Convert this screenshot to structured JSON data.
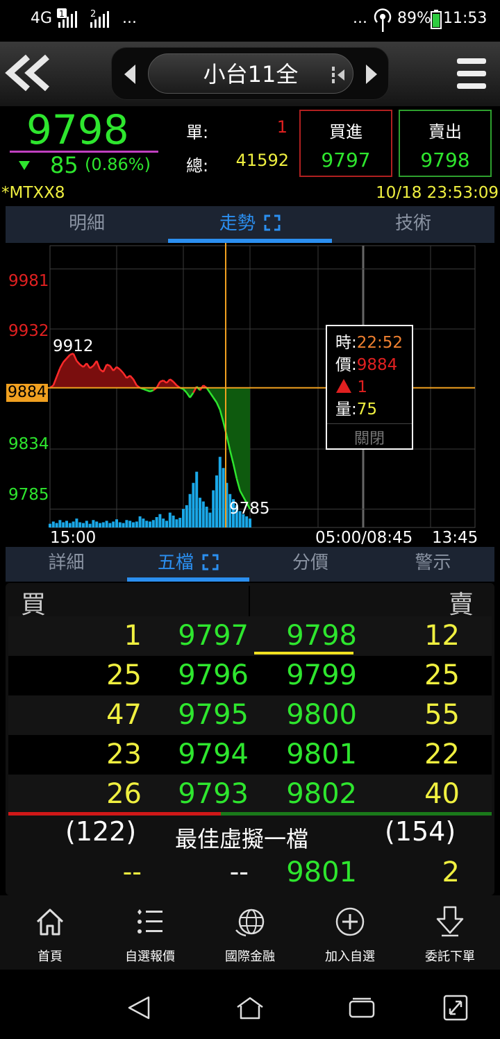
{
  "status": {
    "signal_text": "4G",
    "sim1": "1",
    "sim2": "2",
    "dots_left": "...",
    "dots_right": "...",
    "battery": "89%",
    "time": "11:53"
  },
  "header": {
    "title": "小台11全"
  },
  "quote": {
    "last_price": "9798",
    "change": "85",
    "change_pct": "(0.86%)",
    "single_label": "單:",
    "single_value": "1",
    "total_label": "總:",
    "total_value": "41592",
    "buy_label": "買進",
    "buy_price": "9797",
    "sell_label": "賣出",
    "sell_price": "9798"
  },
  "symbol": {
    "code": "*MTXX8",
    "datetime": "10/18 23:53:09"
  },
  "tabs_top": [
    {
      "label": "明細"
    },
    {
      "label": "走勢"
    },
    {
      "label": "技術"
    }
  ],
  "chart": {
    "y_labels": [
      "9981",
      "9932",
      "9834",
      "9785"
    ],
    "cursor_price": "9884",
    "high_label": "9912",
    "low_label": "9785",
    "x_labels": [
      "15:00",
      "05:00/08:45",
      "13:45"
    ],
    "tooltip": {
      "time_label": "時:",
      "time_value": "22:52",
      "price_label": "價:",
      "price_value": "9884",
      "change_value": "1",
      "vol_label": "量:",
      "vol_value": "75",
      "close_label": "關閉"
    }
  },
  "chart_data": {
    "type": "line",
    "ylim": [
      9770,
      10000
    ],
    "x_session": [
      "15:00",
      "05:00/08:45",
      "13:45"
    ],
    "price_series": [
      9884,
      9886,
      9893,
      9900,
      9905,
      9908,
      9911,
      9912,
      9906,
      9903,
      9901,
      9904,
      9900,
      9902,
      9906,
      9899,
      9897,
      9903,
      9902,
      9898,
      9901,
      9899,
      9896,
      9892,
      9894,
      9891,
      9886,
      9884,
      9883,
      9882,
      9881,
      9882,
      9884,
      9889,
      9890,
      9888,
      9891,
      9889,
      9886,
      9884,
      9883,
      9880,
      9876,
      9880,
      9885,
      9882,
      9886,
      9884,
      9880,
      9876,
      9872,
      9866,
      9856,
      9845,
      9833,
      9822,
      9810,
      9800,
      9795,
      9790,
      9785
    ],
    "volume_series": [
      5,
      8,
      6,
      10,
      7,
      9,
      6,
      8,
      12,
      7,
      6,
      9,
      5,
      10,
      8,
      6,
      7,
      9,
      6,
      8,
      11,
      7,
      6,
      10,
      9,
      7,
      8,
      15,
      12,
      9,
      8,
      10,
      14,
      18,
      12,
      9,
      20,
      16,
      11,
      13,
      25,
      30,
      45,
      60,
      75,
      40,
      35,
      28,
      20,
      50,
      70,
      95,
      80,
      60,
      45,
      38,
      30,
      22,
      18,
      15,
      12
    ],
    "prev_close": 9884,
    "cursor_time": "22:52"
  },
  "tabs_bottom": [
    {
      "label": "詳細"
    },
    {
      "label": "五檔"
    },
    {
      "label": "分價"
    },
    {
      "label": "警示"
    }
  ],
  "orderbook": {
    "buy_header": "買",
    "sell_header": "賣",
    "rows": [
      {
        "bid_qty": "1",
        "bid": "9797",
        "ask": "9798",
        "ask_qty": "12"
      },
      {
        "bid_qty": "25",
        "bid": "9796",
        "ask": "9799",
        "ask_qty": "25"
      },
      {
        "bid_qty": "47",
        "bid": "9795",
        "ask": "9800",
        "ask_qty": "55"
      },
      {
        "bid_qty": "23",
        "bid": "9794",
        "ask": "9801",
        "ask_qty": "22"
      },
      {
        "bid_qty": "26",
        "bid": "9793",
        "ask": "9802",
        "ask_qty": "40"
      }
    ],
    "bid_total": "(122)",
    "ask_total": "(154)",
    "virtual_label": "最佳虛擬一檔",
    "virtual": {
      "bid_qty": "--",
      "bid": "--",
      "ask": "9801",
      "ask_qty": "2"
    },
    "bid_ratio": 0.44
  },
  "nav": [
    {
      "label": "首頁",
      "icon": "home-icon"
    },
    {
      "label": "自選報價",
      "icon": "list-icon"
    },
    {
      "label": "國際金融",
      "icon": "globe-icon"
    },
    {
      "label": "加入自選",
      "icon": "plus-circle-icon"
    },
    {
      "label": "委託下單",
      "icon": "order-icon"
    }
  ],
  "colors": {
    "up": "#e02020",
    "down": "#2ee62e",
    "accent": "#2b8ff0",
    "qty": "#f0f040",
    "cursor": "#f0a020"
  }
}
